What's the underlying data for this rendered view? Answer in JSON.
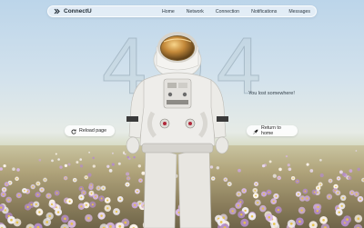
{
  "navbar": {
    "brand": "ConnectU",
    "brand_icon": "connectu-logo-icon",
    "links": [
      {
        "label": "Home"
      },
      {
        "label": "Network"
      },
      {
        "label": "Connection"
      },
      {
        "label": "Notifications"
      },
      {
        "label": "Messages"
      }
    ]
  },
  "hero": {
    "code": "404",
    "tagline": "You lost somewhere!"
  },
  "actions": {
    "reload": {
      "label": "Reload page",
      "icon": "refresh-icon"
    },
    "home": {
      "label": "Return to home",
      "icon": "rocket-icon"
    }
  },
  "colors": {
    "sky_top": "#bcd5ea",
    "field": "#8f8665",
    "nav_bg": "rgba(255,255,255,0.55)"
  }
}
